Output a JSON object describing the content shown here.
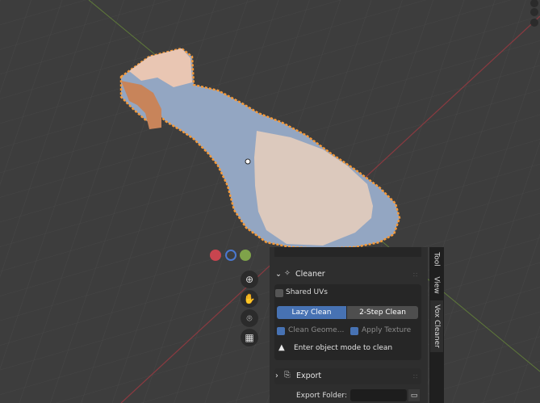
{
  "panel": {
    "cleaner_label": "Cleaner",
    "shared_uvs_label": "Shared UVs",
    "lazy_clean_label": "Lazy Clean",
    "two_step_clean_label": "2-Step Clean",
    "clean_geometry_label": "Clean Geome...",
    "apply_texture_label": "Apply Texture",
    "warning_message": "Enter object mode to clean",
    "export_label": "Export",
    "export_folder_label": "Export Folder:",
    "export_folder_value": ""
  },
  "tabs": [
    "Tool",
    "View",
    "Vox Cleaner"
  ],
  "colors": {
    "accent": "#4772b3",
    "selection": "#f59a3a",
    "axis_x": "#c8454f",
    "axis_y": "#7fa34a"
  }
}
